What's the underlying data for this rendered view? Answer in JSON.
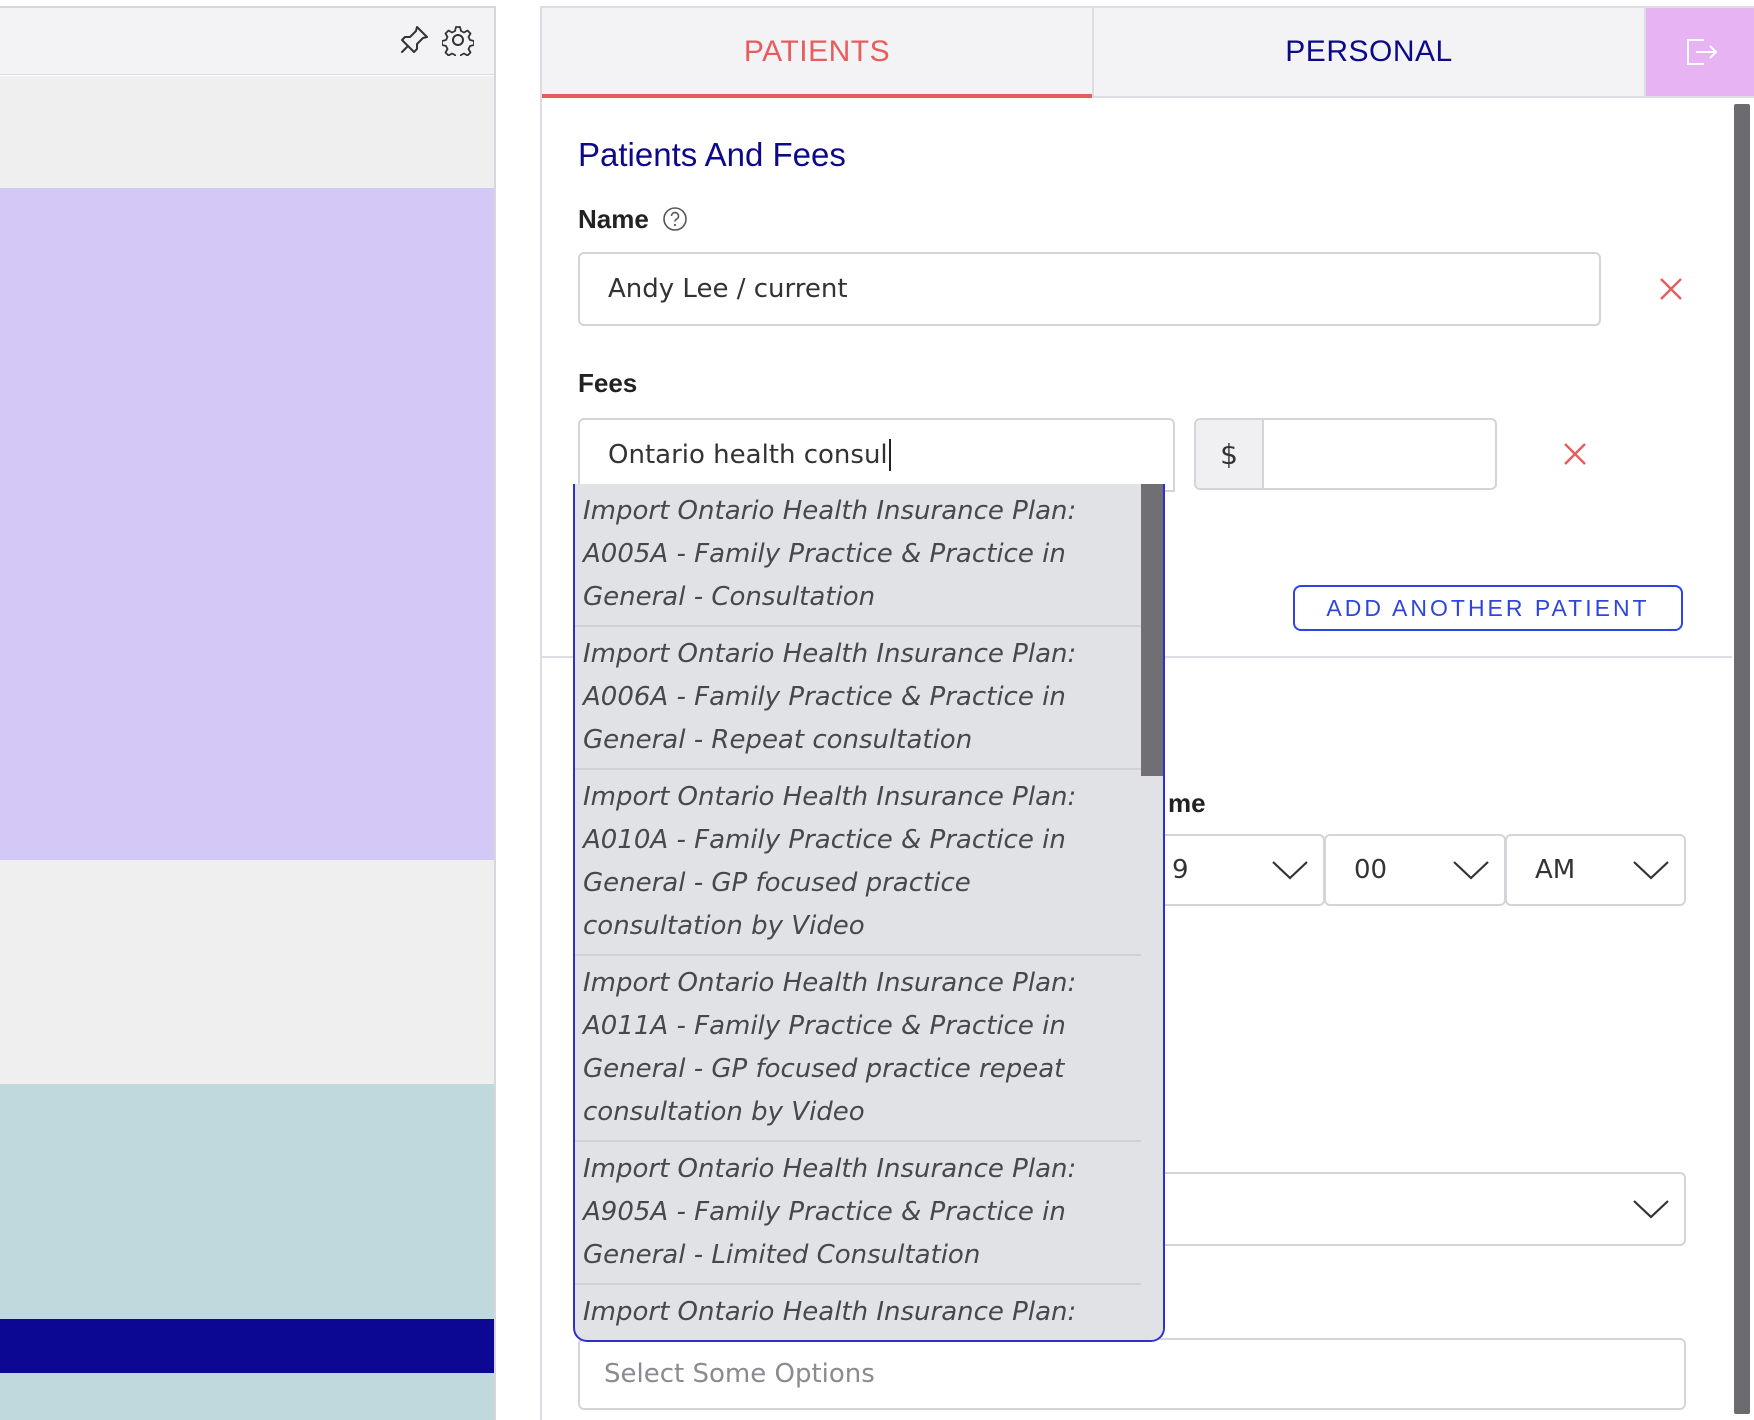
{
  "tabs": {
    "patients_label": "PATIENTS",
    "personal_label": "PERSONAL"
  },
  "form": {
    "section_title": "Patients And Fees",
    "name_label": "Name",
    "name_value": "Andy Lee / current",
    "fees_label": "Fees",
    "fees_search_value": "Ontario health consul",
    "dollar_symbol": "$",
    "amount_value": "",
    "add_patient_label": "ADD ANOTHER PATIENT",
    "time_label_partial": "me",
    "hour_value_partial": "9",
    "minute_value": "00",
    "ampm_value": "AM",
    "multi_select_placeholder": "Select Some Options"
  },
  "dropdown": {
    "options": [
      "Import Ontario Health Insurance Plan: A005A - Family Practice & Practice in General - Consultation",
      "Import Ontario Health Insurance Plan: A006A - Family Practice & Practice in General - Repeat consultation",
      "Import Ontario Health Insurance Plan: A010A - Family Practice & Practice in General - GP focused practice consultation by Video",
      "Import Ontario Health Insurance Plan: A011A - Family Practice & Practice in General - GP focused practice repeat consultation by Video",
      "Import Ontario Health Insurance Plan: A905A - Family Practice & Practice in General - Limited Consultation",
      "Import Ontario Health Insurance Plan:"
    ]
  },
  "colors": {
    "accent_red": "#e85c5c",
    "navy": "#0d0a8a",
    "link_blue": "#2f45e0",
    "appt_purple": "#d3c8f6",
    "appt_teal": "#bfd9dd",
    "logout_pink": "#e7b3f2"
  },
  "icons": {
    "pin": "pin-icon",
    "gear": "gear-icon",
    "logout": "logout-icon",
    "help": "help-icon",
    "remove": "close-icon",
    "chevron": "chevron-down-icon"
  }
}
